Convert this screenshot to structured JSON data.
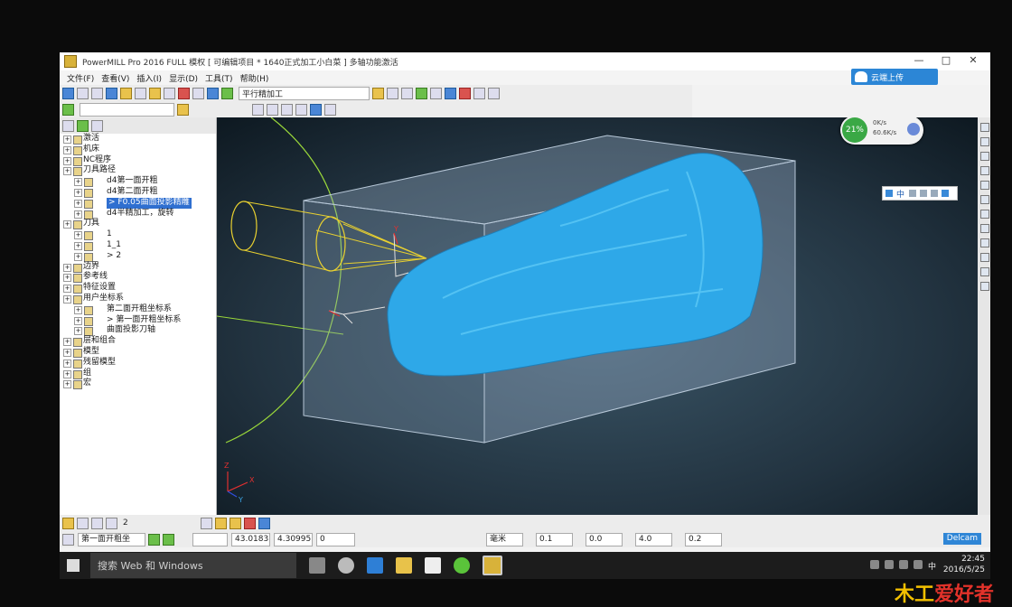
{
  "window": {
    "title": "PowerMILL Pro 2016 FULL 模权   [ 可编辑项目 * 1640正式加工小白菜 ]   多轴功能激活",
    "buttons": [
      "—",
      "□",
      "✕"
    ]
  },
  "menu": [
    "文件(F)",
    "查看(V)",
    "插入(I)",
    "显示(D)",
    "工具(T)",
    "帮助(H)"
  ],
  "cloud_button": "云端上传",
  "toolbar": {
    "strategy_select": "平行精加工"
  },
  "explorer": {
    "items": [
      {
        "label": "激活",
        "indent": 0
      },
      {
        "label": "机床",
        "indent": 0
      },
      {
        "label": "NC程序",
        "indent": 0
      },
      {
        "label": "刀具路径",
        "indent": 0
      },
      {
        "label": "d4第一面开粗",
        "indent": 1
      },
      {
        "label": "d4第二面开粗",
        "indent": 1
      },
      {
        "label": "> F0.05曲面投影精雕",
        "indent": 1,
        "selected": true
      },
      {
        "label": "d4半精加工，旋转",
        "indent": 1
      },
      {
        "label": "刀具",
        "indent": 0
      },
      {
        "label": "1",
        "indent": 1
      },
      {
        "label": "1_1",
        "indent": 1
      },
      {
        "label": "> 2",
        "indent": 1
      },
      {
        "label": "边界",
        "indent": 0
      },
      {
        "label": "参考线",
        "indent": 0
      },
      {
        "label": "特征设置",
        "indent": 0
      },
      {
        "label": "用户坐标系",
        "indent": 0
      },
      {
        "label": "第二面开粗坐标系",
        "indent": 1
      },
      {
        "label": "> 第一面开粗坐标系",
        "indent": 1
      },
      {
        "label": "曲面投影刀轴",
        "indent": 1
      },
      {
        "label": "层和组合",
        "indent": 0
      },
      {
        "label": "模型",
        "indent": 0
      },
      {
        "label": "残留模型",
        "indent": 0
      },
      {
        "label": "组",
        "indent": 0
      },
      {
        "label": "宏",
        "indent": 0
      }
    ]
  },
  "perf_widget": {
    "percent": "21%",
    "upload": "0K/s",
    "download": "60.6K/s"
  },
  "ime_bar": "中",
  "axes": {
    "y": "Y",
    "z": "Z",
    "x": "X"
  },
  "bottom_bar": {
    "count": "2",
    "workplane": "第一面开粗坐",
    "coord_x": "43.0183",
    "coord_y": "4.30995",
    "coord_z": "0",
    "unit": "毫米",
    "tol": "0.1",
    "thick": "0.0",
    "step": "4.0",
    "extra": "0.2",
    "brand": "Delcam"
  },
  "taskbar": {
    "search": "搜索 Web 和 Windows",
    "time": "22:45",
    "date": "2016/5/25",
    "ime": "中"
  },
  "watermark": {
    "a": "木工",
    "b": "爱好者"
  }
}
